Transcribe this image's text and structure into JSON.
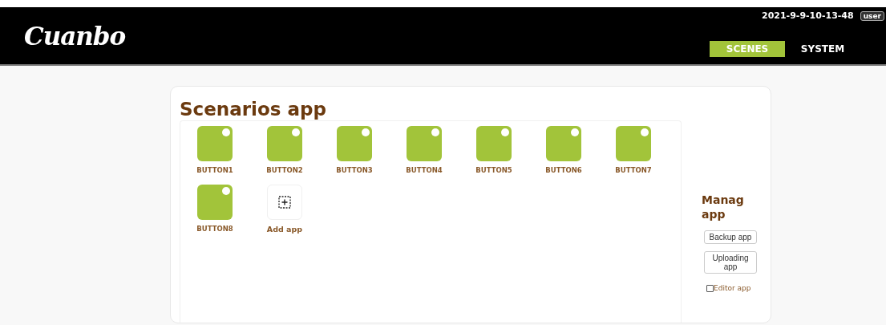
{
  "header": {
    "logo": "Cuanbo",
    "datetime": "2021-9-9-10-13-48",
    "user": "user"
  },
  "tabs": [
    {
      "label": "SCENES",
      "selected": true
    },
    {
      "label": "SYSTEM",
      "selected": false
    }
  ],
  "main": {
    "title": "Scenarios app",
    "apps": [
      {
        "kind": "app",
        "label": "BUTTON1"
      },
      {
        "kind": "app",
        "label": "BUTTON2"
      },
      {
        "kind": "app",
        "label": "BUTTON3"
      },
      {
        "kind": "app",
        "label": "BUTTON4"
      },
      {
        "kind": "app",
        "label": "BUTTON5"
      },
      {
        "kind": "app",
        "label": "BUTTON6"
      },
      {
        "kind": "app",
        "label": "BUTTON7"
      },
      {
        "kind": "app",
        "label": "BUTTON8"
      },
      {
        "kind": "add",
        "label": "Add app"
      }
    ]
  },
  "manage": {
    "title": "Manag app",
    "buttons": [
      "Backup app",
      "Uploading app"
    ],
    "editor": {
      "label": "Editor app",
      "checked": false
    }
  }
}
